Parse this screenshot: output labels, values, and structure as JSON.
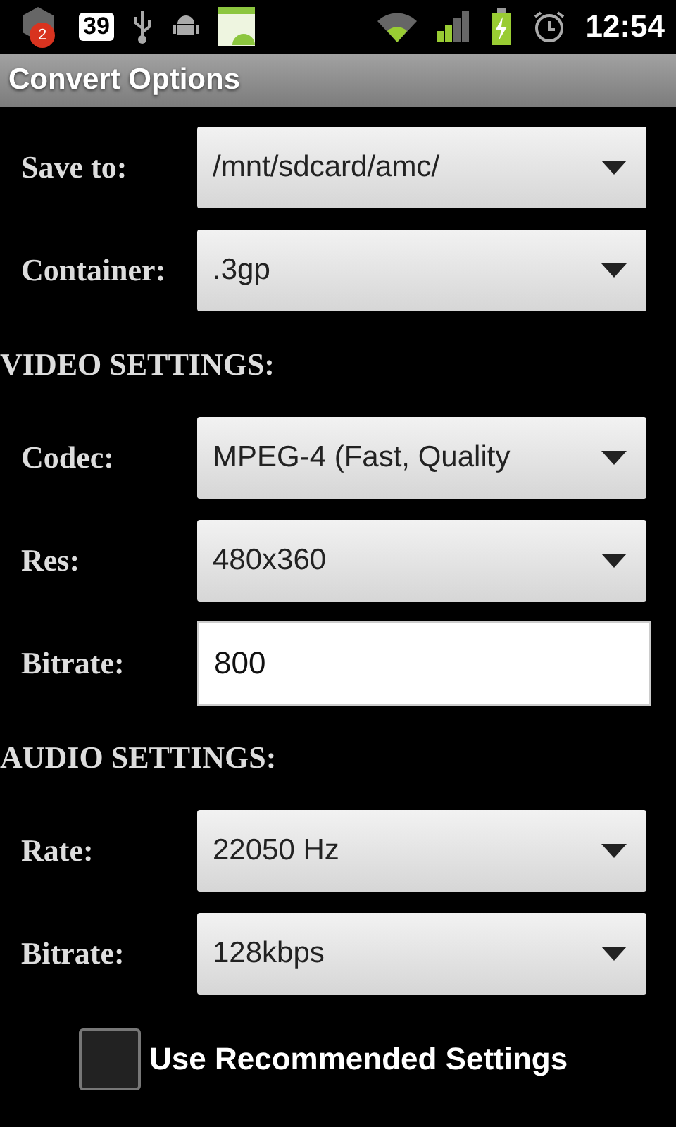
{
  "status_bar": {
    "notification_count": "2",
    "badge": "39",
    "time": "12:54"
  },
  "title": "Convert Options",
  "sections": [
    {
      "rows": [
        {
          "label": "Save to:",
          "kind": "spinner",
          "value": "/mnt/sdcard/amc/"
        },
        {
          "label": "Container:",
          "kind": "spinner",
          "value": ".3gp"
        }
      ]
    },
    {
      "heading": "VIDEO SETTINGS:",
      "rows": [
        {
          "label": "Codec:",
          "kind": "spinner",
          "value": "MPEG-4 (Fast, Quality"
        },
        {
          "label": "Res:",
          "kind": "spinner",
          "value": "480x360"
        },
        {
          "label": "Bitrate:",
          "kind": "input",
          "value": "800"
        }
      ]
    },
    {
      "heading": "AUDIO SETTINGS:",
      "rows": [
        {
          "label": "Rate:",
          "kind": "spinner",
          "value": "22050 Hz"
        },
        {
          "label": "Bitrate:",
          "kind": "spinner",
          "value": "128kbps"
        }
      ]
    }
  ],
  "checkbox": {
    "label": "Use Recommended Settings",
    "checked": false
  }
}
